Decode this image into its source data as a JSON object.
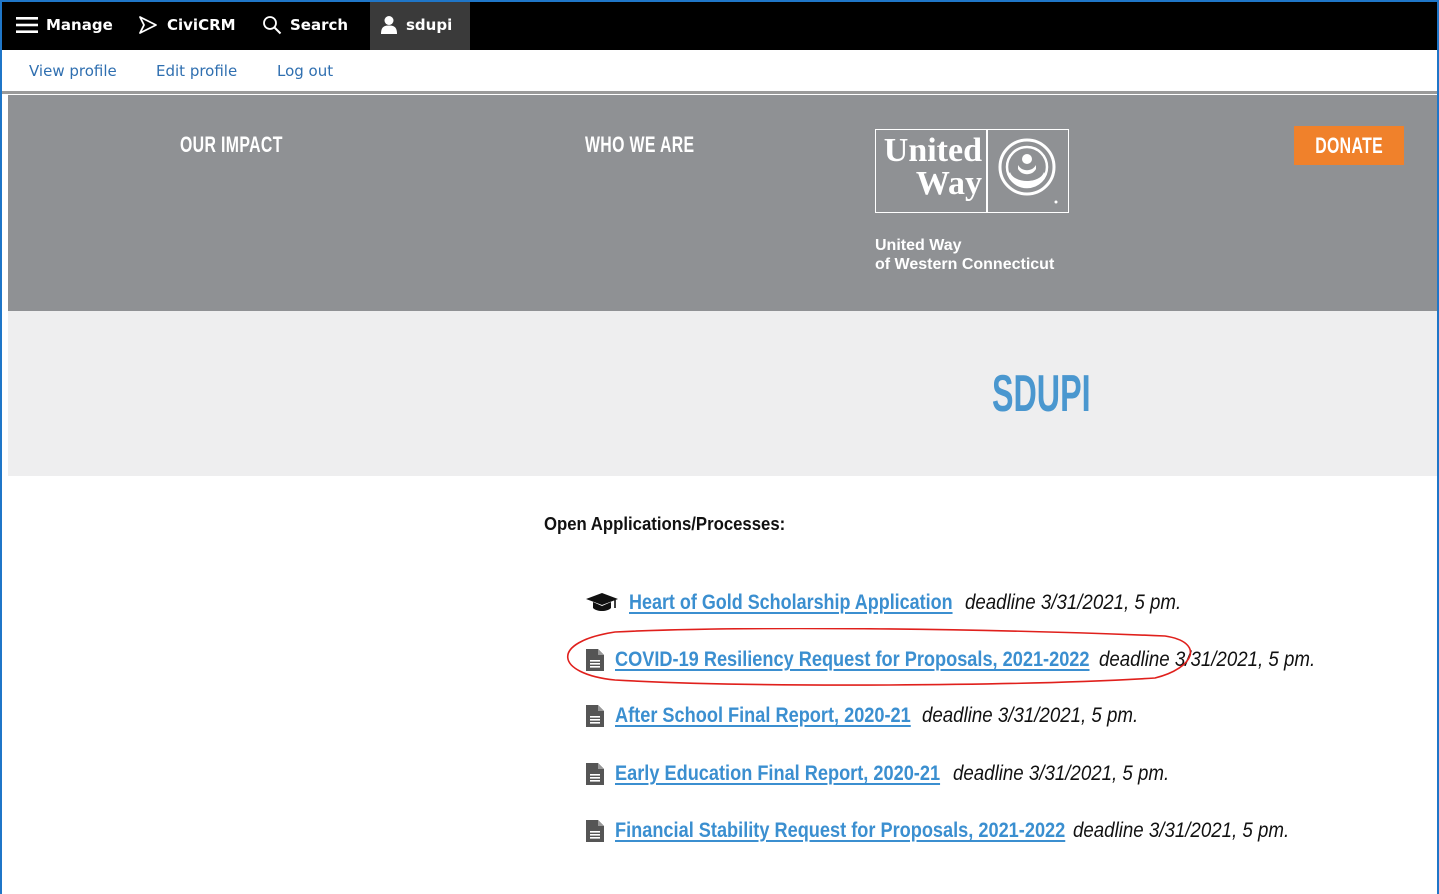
{
  "toolbar": {
    "manage_label": "Manage",
    "civicrm_label": "CiviCRM",
    "search_label": "Search",
    "user_label": "sdupi"
  },
  "user_tray": {
    "view_profile": "View profile",
    "edit_profile": "Edit profile",
    "log_out": "Log out"
  },
  "site_header": {
    "nav": [
      "OUR IMPACT",
      "WHO WE ARE"
    ],
    "logo_line1": "United",
    "logo_line2": "Way",
    "org_line1": "United Way",
    "org_line2": "of Western Connecticut",
    "donate_label": "DONATE"
  },
  "page": {
    "title": "SDUPI",
    "section_heading": "Open Applications/Processes:"
  },
  "applications": [
    {
      "icon": "graduation-cap-icon",
      "title": "Heart of Gold Scholarship Application",
      "deadline": "deadline 3/31/2021, 5 pm."
    },
    {
      "icon": "document-icon",
      "title": "COVID-19 Resiliency Request for Proposals, 2021-2022",
      "deadline": "deadline 3/31/2021, 5 pm."
    },
    {
      "icon": "document-icon",
      "title": "After School Final Report, 2020-21",
      "deadline": "deadline 3/31/2021, 5 pm."
    },
    {
      "icon": "document-icon",
      "title": "Early Education Final Report, 2020-21",
      "deadline": "deadline 3/31/2021, 5 pm."
    },
    {
      "icon": "document-icon",
      "title": "Financial Stability Request for Proposals, 2021-2022",
      "deadline": "deadline 3/31/2021, 5 pm."
    }
  ],
  "colors": {
    "toolbar_bg": "#000000",
    "header_bg": "#8f9194",
    "title_band_bg": "#eeeeef",
    "accent_blue": "#3b8fd0",
    "donate_orange": "#f0812b",
    "annotation_red": "#e0201c"
  }
}
